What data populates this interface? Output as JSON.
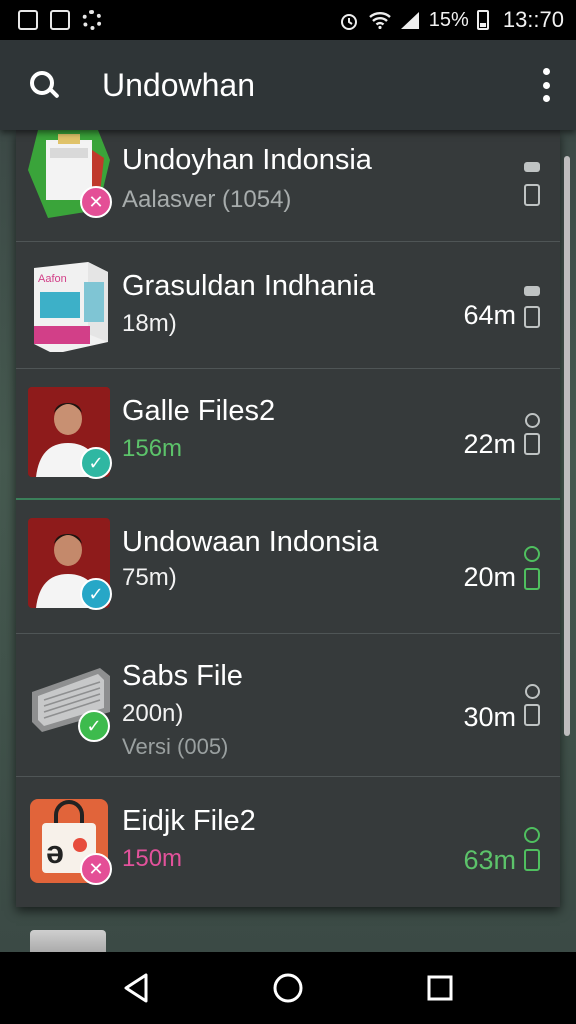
{
  "status_bar": {
    "battery": "15%",
    "time": "13::70"
  },
  "app_bar": {
    "title": "Undowhan"
  },
  "items": [
    {
      "name": "Undoyhan Indonsia",
      "sub": "Aalasver (1054)",
      "size": "",
      "badge": "x"
    },
    {
      "name": "Grasuldan Indhania",
      "sub": "18m)",
      "size": "64m",
      "badge": ""
    },
    {
      "name": "Galle Files2",
      "sub": "156m",
      "size": "22m",
      "badge": "check"
    },
    {
      "name": "Undowaan Indonsia",
      "sub": "75m)",
      "size": "20m",
      "badge": "check"
    },
    {
      "name": "Sabs File",
      "sub": "200n)",
      "sub2": "Versi (005)",
      "size": "30m",
      "badge": "check"
    },
    {
      "name": "Eidjk File2",
      "sub": "150m",
      "size": "63m",
      "badge": "x"
    }
  ],
  "colors": {
    "app_bar": "#2f3537",
    "list_bg": "#363a3b",
    "accent_green": "#5cc36a",
    "accent_pink": "#e2529b"
  }
}
